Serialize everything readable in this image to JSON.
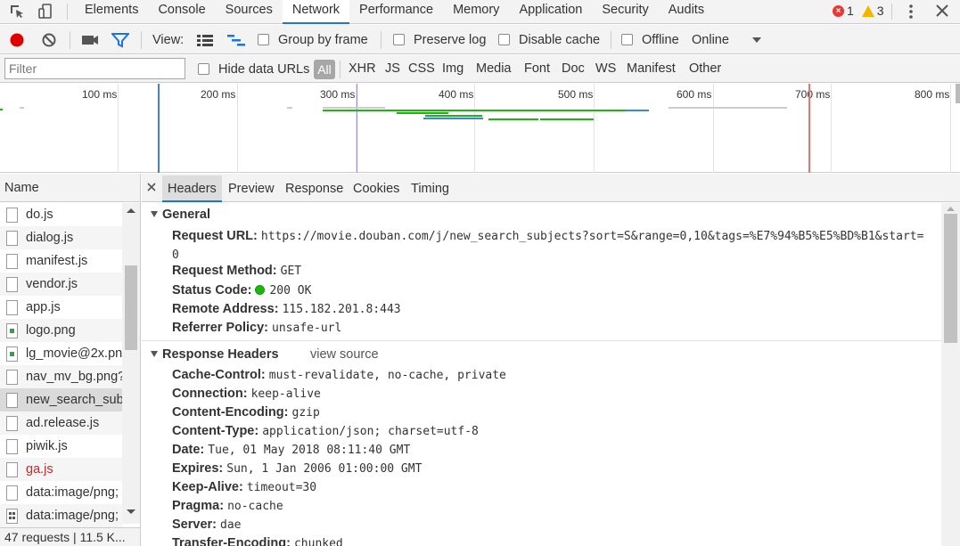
{
  "tabbar": {
    "tabs": [
      {
        "label": "Elements"
      },
      {
        "label": "Console"
      },
      {
        "label": "Sources"
      },
      {
        "label": "Network"
      },
      {
        "label": "Performance"
      },
      {
        "label": "Memory"
      },
      {
        "label": "Application"
      },
      {
        "label": "Security"
      },
      {
        "label": "Audits"
      }
    ],
    "active_tab": "Network",
    "error_count": "1",
    "warning_count": "3",
    "error_color": "#e53935",
    "warning_color": "#f2b600"
  },
  "toolbar": {
    "view_label": "View:",
    "group_by_frame": "Group by frame",
    "preserve_log": "Preserve log",
    "disable_cache": "Disable cache",
    "offline": "Offline",
    "throttle": "Online",
    "record_color": "#e00000",
    "filter_icon_color": "#1a73e8"
  },
  "filterbar": {
    "placeholder": "Filter",
    "hide_data_urls": "Hide data URLs",
    "types": [
      "All",
      "XHR",
      "JS",
      "CSS",
      "Img",
      "Media",
      "Font",
      "Doc",
      "WS",
      "Manifest",
      "Other"
    ]
  },
  "overview": {
    "ticks": [
      "100 ms",
      "200 ms",
      "300 ms",
      "400 ms",
      "500 ms",
      "600 ms",
      "700 ms",
      "800 ms"
    ]
  },
  "leftpanel": {
    "name_header": "Name",
    "files": [
      {
        "name": "do.js",
        "icon": "file-icon"
      },
      {
        "name": "dialog.js",
        "icon": "file-icon"
      },
      {
        "name": "manifest.js",
        "icon": "file-icon"
      },
      {
        "name": "vendor.js",
        "icon": "file-icon"
      },
      {
        "name": "app.js",
        "icon": "file-icon"
      },
      {
        "name": "logo.png",
        "icon": "image-icon"
      },
      {
        "name": "lg_movie@2x.pn",
        "icon": "image-icon"
      },
      {
        "name": "nav_mv_bg.png?",
        "icon": "file-icon"
      },
      {
        "name": "new_search_subj",
        "icon": "file-icon"
      },
      {
        "name": "ad.release.js",
        "icon": "file-icon"
      },
      {
        "name": "piwik.js",
        "icon": "file-icon"
      },
      {
        "name": "ga.js",
        "icon": "file-icon"
      },
      {
        "name": "data:image/png;",
        "icon": "file-icon"
      },
      {
        "name": "data:image/png;",
        "icon": "grid-icon"
      }
    ],
    "status": "47 requests  |  11.5 K..."
  },
  "detail": {
    "tabs": [
      "Headers",
      "Preview",
      "Response",
      "Cookies",
      "Timing"
    ],
    "active_tab": "Headers",
    "general": {
      "title": "General",
      "request_url_key": "Request URL:",
      "request_url": "https://movie.douban.com/j/new_search_subjects?sort=S&range=0,10&tags=%E7%94%B5%E5%BD%B1&start=0",
      "method_key": "Request Method:",
      "method": "GET",
      "status_key": "Status Code:",
      "status": "200 OK",
      "remote_key": "Remote Address:",
      "remote": "115.182.201.8:443",
      "referrer_key": "Referrer Policy:",
      "referrer": "unsafe-url"
    },
    "response_headers": {
      "title": "Response Headers",
      "view_source": "view source",
      "items": [
        {
          "k": "Cache-Control:",
          "v": "must-revalidate, no-cache, private"
        },
        {
          "k": "Connection:",
          "v": "keep-alive"
        },
        {
          "k": "Content-Encoding:",
          "v": "gzip"
        },
        {
          "k": "Content-Type:",
          "v": "application/json; charset=utf-8"
        },
        {
          "k": "Date:",
          "v": "Tue, 01 May 2018 08:11:40 GMT"
        },
        {
          "k": "Expires:",
          "v": "Sun, 1 Jan 2006 01:00:00 GMT"
        },
        {
          "k": "Keep-Alive:",
          "v": "timeout=30"
        },
        {
          "k": "Pragma:",
          "v": "no-cache"
        },
        {
          "k": "Server:",
          "v": "dae"
        },
        {
          "k": "Transfer-Encoding:",
          "v": "chunked"
        }
      ]
    }
  }
}
